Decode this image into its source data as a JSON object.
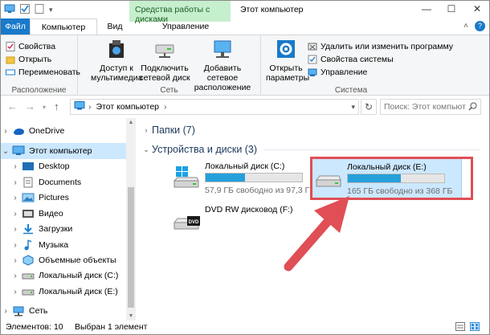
{
  "window": {
    "title": "Этот компьютер",
    "context_tab": "Средства работы с дисками",
    "minimize_glyph": "—",
    "maximize_glyph": "☐",
    "close_glyph": "✕",
    "help_glyph": "?",
    "collapse_glyph": "˄"
  },
  "tabs": {
    "file": "Файл",
    "computer": "Компьютер",
    "view": "Вид",
    "manage": "Управление"
  },
  "ribbon": {
    "location": {
      "properties": "Свойства",
      "open": "Открыть",
      "rename": "Переименовать",
      "label": "Расположение"
    },
    "network": {
      "media_access_l1": "Доступ к",
      "media_access_l2": "мультимедиа",
      "map_drive_l1": "Подключить",
      "map_drive_l2": "сетевой диск",
      "add_location_l1": "Добавить сетевое",
      "add_location_l2": "расположение",
      "label": "Сеть"
    },
    "system": {
      "open_settings_l1": "Открыть",
      "open_settings_l2": "параметры",
      "uninstall": "Удалить или изменить программу",
      "system_props": "Свойства системы",
      "manage": "Управление",
      "label": "Система"
    }
  },
  "address": {
    "path": "Этот компьютер",
    "search_placeholder": "Поиск: Этот компьют"
  },
  "nav": {
    "items": [
      {
        "label": "OneDrive"
      },
      {
        "label": "Этот компьютер"
      },
      {
        "label": "Desktop"
      },
      {
        "label": "Documents"
      },
      {
        "label": "Pictures"
      },
      {
        "label": "Видео"
      },
      {
        "label": "Загрузки"
      },
      {
        "label": "Музыка"
      },
      {
        "label": "Объемные объекты"
      },
      {
        "label": "Локальный диск (C:)"
      },
      {
        "label": "Локальный диск (E:)"
      },
      {
        "label": "Сеть"
      }
    ]
  },
  "content": {
    "folders_header": "Папки (7)",
    "devices_header": "Устройства и диски (3)",
    "drives": [
      {
        "name": "Локальный диск (C:)",
        "free": "57,9 ГБ свободно из 97,3 ГБ",
        "used_fraction": 0.405
      },
      {
        "name": "Локальный диск (E:)",
        "free": "165 ГБ свободно из 368 ГБ",
        "used_fraction": 0.552
      },
      {
        "name": "DVD RW дисковод (F:)"
      }
    ]
  },
  "status": {
    "count": "Элементов: 10",
    "selected": "Выбран 1 элемент"
  },
  "colors": {
    "accent": "#1979ca",
    "drive_bar": "#26a0da",
    "selection": "#cce8ff",
    "arrow": "#e04e56",
    "context_tab": "#c6efce"
  }
}
